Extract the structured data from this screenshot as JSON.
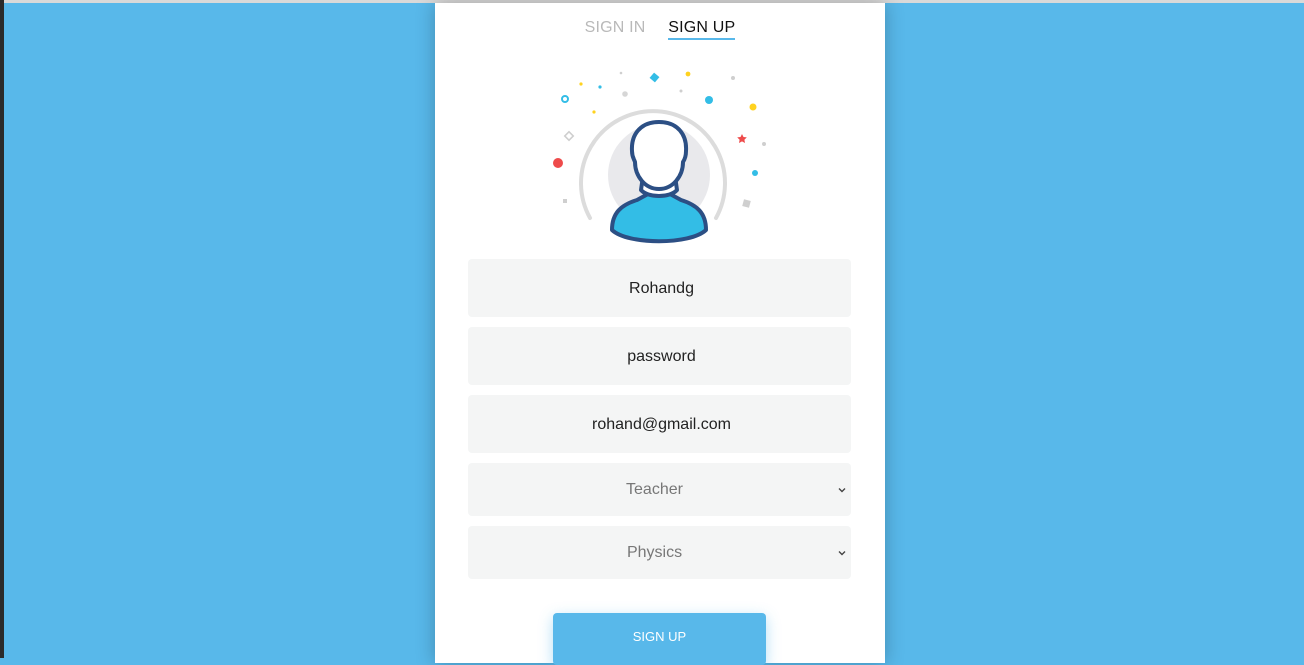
{
  "tabs": {
    "signin": "SIGN IN",
    "signup": "SIGN UP"
  },
  "form": {
    "username_value": "Rohandg",
    "password_value": "password",
    "email_value": "rohand@gmail.com",
    "role_selected": "Teacher",
    "subject_selected": "Physics",
    "submit_label": "SIGN UP"
  },
  "colors": {
    "background": "#58b8ea",
    "card": "#ffffff",
    "field": "#f4f5f5",
    "accent": "#58b8ea",
    "avatar_shirt": "#33bde6",
    "avatar_outline": "#2c4f84"
  },
  "icons": {
    "avatar": "user-avatar-icon",
    "dropdown": "chevron-down-icon"
  }
}
